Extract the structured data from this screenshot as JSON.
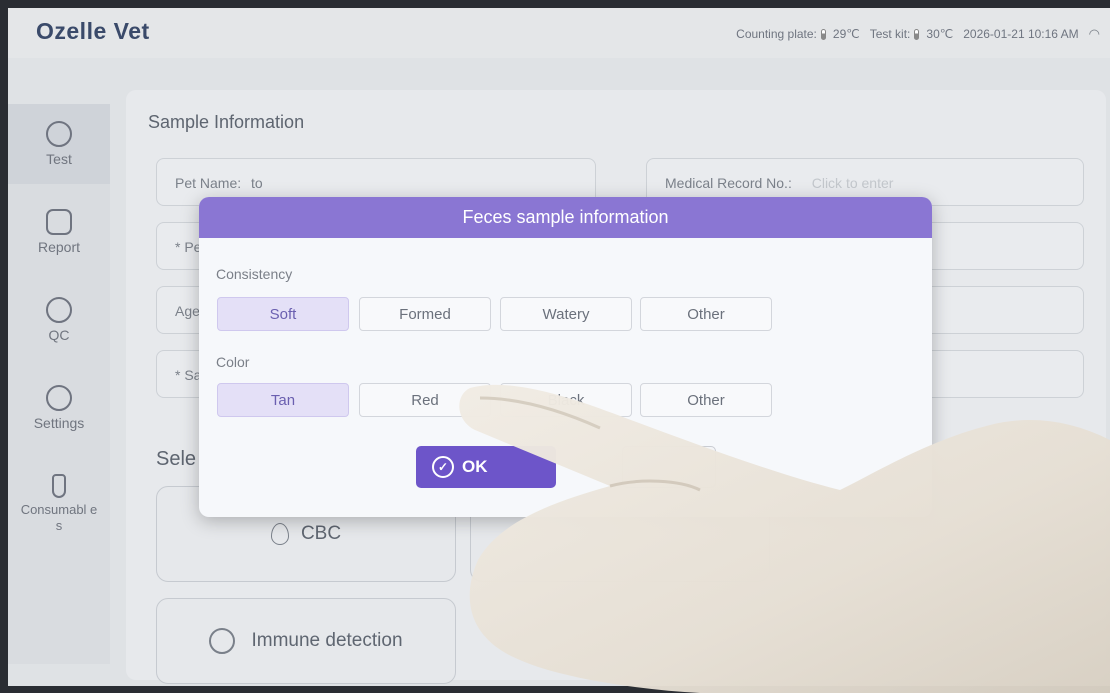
{
  "app": {
    "title": "Ozelle Vet"
  },
  "status": {
    "counting_plate_label": "Counting plate:",
    "counting_plate_temp": "29℃",
    "test_kit_label": "Test kit:",
    "test_kit_temp": "30℃",
    "datetime": "2026-01-21 10:16 AM"
  },
  "sidebar": {
    "items": [
      {
        "label": "Test",
        "icon": "test-icon",
        "active": true
      },
      {
        "label": "Report",
        "icon": "folder-icon"
      },
      {
        "label": "QC",
        "icon": "qc-icon"
      },
      {
        "label": "Settings",
        "icon": "gear-icon"
      },
      {
        "label": "Consumabl es",
        "icon": "tube-icon"
      }
    ]
  },
  "sample_info": {
    "title": "Sample Information",
    "pet_name_label": "Pet Name:",
    "pet_name_value": "to",
    "medical_record_label": "Medical Record No.:",
    "medical_record_placeholder": "Click to enter",
    "field_pet_prefix": "* Pet",
    "field_age_prefix": "Age",
    "field_sam_prefix": "* Sam"
  },
  "select_test": {
    "title_partial": "Sele",
    "cbc_label": "CBC",
    "immune_label": "Immune detection"
  },
  "dialog": {
    "title": "Feces sample information",
    "consistency_label": "Consistency",
    "consistency_options": [
      "Soft",
      "Formed",
      "Watery",
      "Other"
    ],
    "consistency_selected": "Soft",
    "color_label": "Color",
    "color_options": [
      "Tan",
      "Red",
      "Black",
      "Other"
    ],
    "color_selected": "Tan",
    "ok_label": "OK"
  },
  "colors": {
    "accent": "#6d55c9",
    "header": "#8a76d3",
    "selected_option": "#e4e0f7"
  }
}
